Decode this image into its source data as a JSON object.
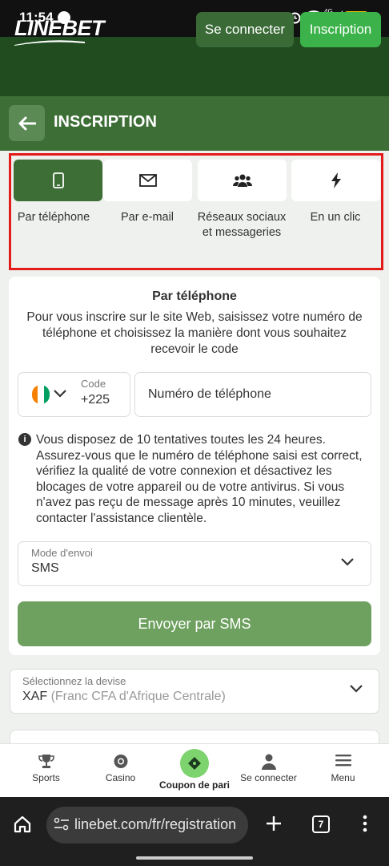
{
  "status_bar": {
    "time": "11:54",
    "network": "4G",
    "battery": "100"
  },
  "header": {
    "logo": "LINEBET",
    "connect_label": "Se connecter",
    "register_label": "Inscription"
  },
  "title_bar": {
    "title": "INSCRIPTION"
  },
  "methods": {
    "tabs": [
      {
        "label": "Par téléphone",
        "icon": "phone-icon",
        "active": true
      },
      {
        "label": "Par e-mail",
        "icon": "envelope-icon",
        "active": false
      },
      {
        "label": "Réseaux sociaux et messageries",
        "icon": "users-icon",
        "active": false
      },
      {
        "label": "En un clic",
        "icon": "lightning-icon",
        "active": false
      }
    ]
  },
  "form": {
    "title": "Par téléphone",
    "description": "Pour vous inscrire sur le site Web, saisissez votre numéro de téléphone et choisissez la manière dont vous souhaitez recevoir le code",
    "code_label": "Code",
    "code_value": "+225",
    "phone_placeholder": "Numéro de téléphone",
    "info_text": "Vous disposez de 10 tentatives toutes les 24 heures. Assurez-vous que le numéro de téléphone saisi est correct, vérifiez la qualité de votre connexion et désactivez les blocages de votre appareil ou de votre antivirus. Si vous n'avez pas reçu de message après 10 minutes, veuillez contacter l'assistance clientèle.",
    "mode_label": "Mode d'envoi",
    "mode_value": "SMS",
    "send_label": "Envoyer par SMS"
  },
  "currency": {
    "label": "Sélectionnez la devise",
    "code": "XAF",
    "name": "(Franc CFA d'Afrique Centrale)"
  },
  "bottom_nav": {
    "items": [
      {
        "label": "Sports",
        "icon": "trophy-icon"
      },
      {
        "label": "Casino",
        "icon": "chip-icon"
      },
      {
        "label": "Coupon de pari",
        "icon": "ticket-icon"
      },
      {
        "label": "Se connecter",
        "icon": "user-icon"
      },
      {
        "label": "Menu",
        "icon": "menu-icon"
      }
    ]
  },
  "browser": {
    "url": "linebet.com/fr/registration",
    "tab_count": "7"
  },
  "colors": {
    "brand_dark": "#204c20",
    "brand": "#3d6e36",
    "accent": "#3cb34a",
    "send_button": "#6ea15f",
    "highlight": "#e31b1b"
  }
}
